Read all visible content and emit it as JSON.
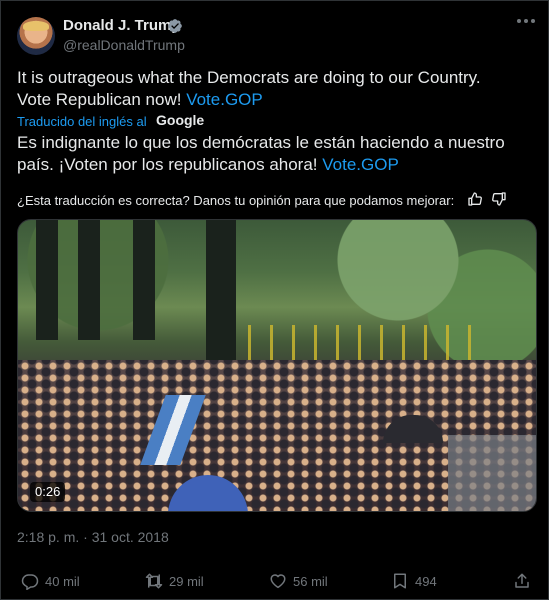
{
  "author": {
    "name": "Donald J. Trump",
    "handle": "@realDonaldTrump"
  },
  "tweet": {
    "text": "It is outrageous what the Democrats are doing to our Country. Vote Republican now!",
    "link": "Vote.GOP"
  },
  "translation": {
    "by_label": "Traducido del inglés al",
    "provider": "Google",
    "text": "Es indignante lo que los demócratas le están haciendo a nuestro país. ¡Voten por los republicanos ahora!",
    "link": "Vote.GOP",
    "feedback": "¿Esta traducción es correcta? Danos tu opinión para que podamos mejorar:"
  },
  "media": {
    "duration": "0:26"
  },
  "timestamp": "2:18 p. m. · 31 oct. 2018",
  "actions": {
    "replies": "40 mil",
    "reposts": "29 mil",
    "likes": "56 mil",
    "bookmarks": "494"
  },
  "icons": {
    "verified": "verified-badge-icon",
    "more": "more-icon",
    "reply": "reply-icon",
    "repost": "repost-icon",
    "like": "heart-icon",
    "bookmark": "bookmark-icon",
    "share": "share-icon",
    "thumb_up": "thumb-up-icon",
    "thumb_down": "thumb-down-icon"
  },
  "colors": {
    "background": "#000000",
    "text": "#e7e9ea",
    "secondary": "#71767b",
    "accent": "#1d9bf0",
    "border": "#2f3336"
  }
}
